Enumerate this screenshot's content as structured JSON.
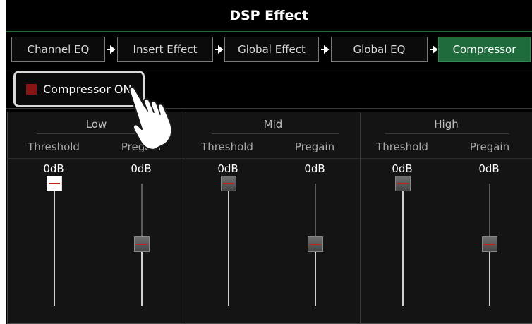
{
  "title": "DSP Effect",
  "tabs": [
    {
      "label": "Channel EQ",
      "active": false
    },
    {
      "label": "Insert Effect",
      "active": false
    },
    {
      "label": "Global Effect",
      "active": false
    },
    {
      "label": "Global EQ",
      "active": false
    },
    {
      "label": "Compressor",
      "active": true
    }
  ],
  "compressor_toggle": {
    "label": "Compressor ON",
    "state": "on",
    "indicator_color": "#8a1414"
  },
  "bands": [
    {
      "name": "Low",
      "threshold": {
        "label": "Threshold",
        "value": "0dB"
      },
      "pregain": {
        "label": "Pregain",
        "value": "0dB"
      }
    },
    {
      "name": "Mid",
      "threshold": {
        "label": "Threshold",
        "value": "0dB"
      },
      "pregain": {
        "label": "Pregain",
        "value": "0dB"
      }
    },
    {
      "name": "High",
      "threshold": {
        "label": "Threshold",
        "value": "0dB"
      },
      "pregain": {
        "label": "Pregain",
        "value": "0dB"
      }
    }
  ],
  "colors": {
    "accent": "#1f6b3c",
    "background": "#000000",
    "slider_mark": "#c32020"
  },
  "icons": {
    "tab_arrow": "arrow-right-icon",
    "pointer": "hand-pointer-icon"
  }
}
